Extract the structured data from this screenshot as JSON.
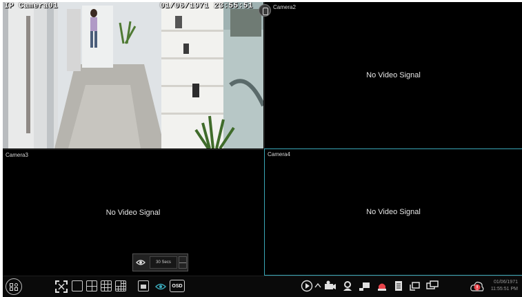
{
  "panes": [
    {
      "label": "IP Camera01",
      "timestamp": "01/06/1971 23:55:51"
    },
    {
      "label": "Camera2",
      "message": "No Video Signal"
    },
    {
      "label": "Camera3",
      "message": "No Video Signal"
    },
    {
      "label": "Camera4",
      "message": "No Video Signal"
    }
  ],
  "dwell_popup": {
    "seconds_label": "30 Secs"
  },
  "toolbar": {
    "osd_label": "OSD",
    "left_icons": [
      "menu-icon",
      "fullscreen-icon",
      "single-view-icon",
      "quad-view-icon",
      "nine-view-icon",
      "sixteen-view-icon",
      "pip-icon",
      "dwell-icon"
    ],
    "right_icons": [
      "playback-icon",
      "chevron-up-icon",
      "ptz-camera-icon",
      "manual-record-icon",
      "snapshot-icon",
      "alarm-icon",
      "event-log-icon",
      "sequence-icon",
      "output-switch-icon"
    ],
    "date": "01/06/1971",
    "time": "11:55:51 PM"
  },
  "colors": {
    "accent": "#3aa7b8",
    "background": "#000000"
  }
}
